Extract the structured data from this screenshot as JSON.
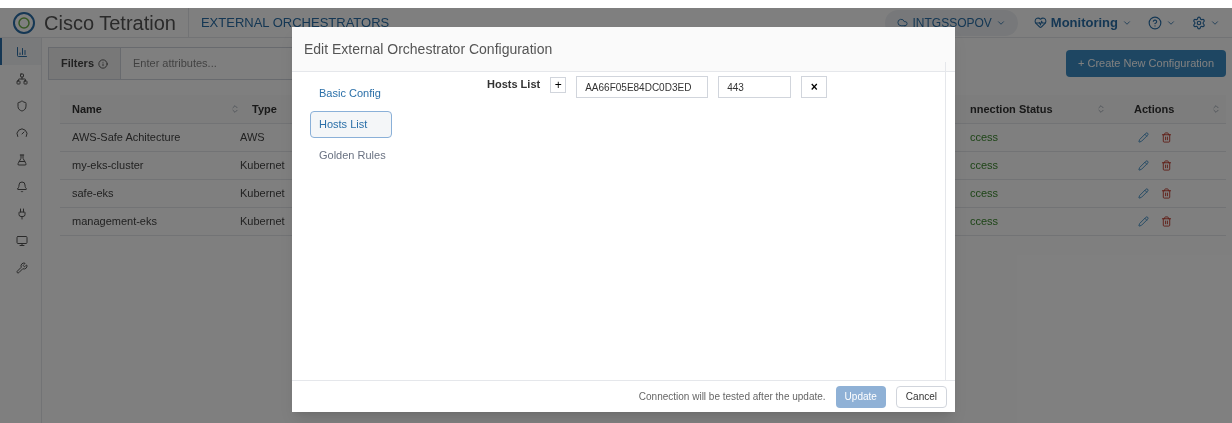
{
  "header": {
    "brand": "Cisco Tetration",
    "page_title": "EXTERNAL ORCHESTRATORS",
    "menus": [
      {
        "kind": "scope",
        "label": "INTGSSOPOV"
      },
      {
        "kind": "monitoring",
        "label": "Monitoring"
      },
      {
        "kind": "help"
      },
      {
        "kind": "settings"
      }
    ]
  },
  "sidebar": {
    "items": [
      {
        "kind": "dashboard",
        "selected": true
      },
      {
        "kind": "topology",
        "selected": false
      },
      {
        "kind": "security",
        "selected": false
      },
      {
        "kind": "gauge",
        "selected": false
      },
      {
        "kind": "lab",
        "selected": false
      },
      {
        "kind": "alerts",
        "selected": false
      },
      {
        "kind": "plug",
        "selected": false
      },
      {
        "kind": "device",
        "selected": false
      },
      {
        "kind": "tools",
        "selected": false
      }
    ]
  },
  "filters": {
    "label": "Filters",
    "placeholder": "Enter attributes..."
  },
  "create_button": "+ Create New Configuration",
  "table": {
    "columns": [
      {
        "label": "Name",
        "sortable": true
      },
      {
        "label": "Type",
        "sortable": false
      },
      {
        "label": "nnection Status",
        "sortable": true
      },
      {
        "label": "Actions",
        "sortable": true
      }
    ],
    "rows": [
      {
        "name": "AWS-Safe Achitecture",
        "type": "AWS",
        "status": "ccess"
      },
      {
        "name": "my-eks-cluster",
        "type": "Kubernet",
        "status": "ccess"
      },
      {
        "name": "safe-eks",
        "type": "Kubernet",
        "status": "ccess"
      },
      {
        "name": "management-eks",
        "type": "Kubernet",
        "status": "ccess"
      }
    ]
  },
  "modal": {
    "title": "Edit External Orchestrator Configuration",
    "nav": [
      {
        "label": "Basic Config",
        "selected": false,
        "disabled": false
      },
      {
        "label": "Hosts List",
        "selected": true,
        "disabled": false
      },
      {
        "label": "Golden Rules",
        "selected": false,
        "disabled": true
      }
    ],
    "hosts": {
      "label": "Hosts List",
      "add": "+",
      "entries": [
        {
          "host": "AA66F05E84DC0D3ED",
          "port": "443",
          "remove": "×"
        }
      ]
    },
    "footer": {
      "note": "Connection will be tested after the update.",
      "buttons": [
        {
          "label": "Update",
          "disabled": true
        },
        {
          "label": "Cancel",
          "disabled": false
        }
      ]
    }
  }
}
